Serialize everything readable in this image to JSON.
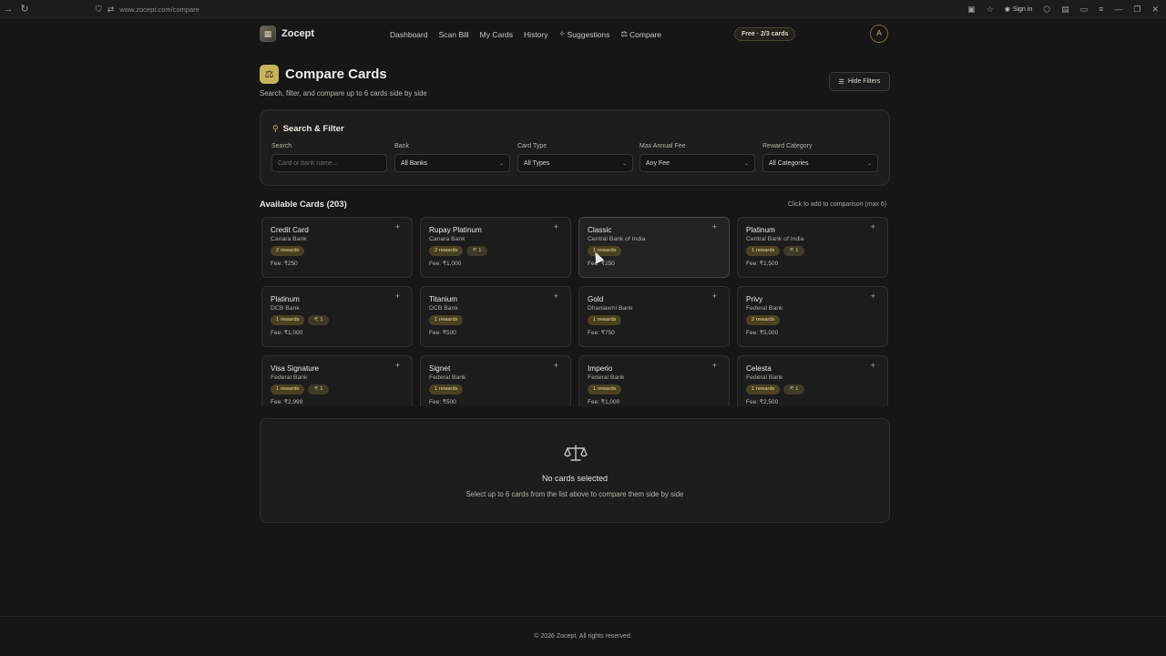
{
  "browser": {
    "url": "www.zocept.com/compare",
    "sign_in": "Sign in"
  },
  "header": {
    "logo": "Zocept",
    "nav": [
      "Dashboard",
      "Scan Bill",
      "My Cards",
      "History",
      "Suggestions",
      "Compare"
    ],
    "plan_badge": "Free · 2/3 cards",
    "avatar": "A"
  },
  "page": {
    "title": "Compare Cards",
    "subtitle": "Search, filter, and compare up to 6 cards side by side",
    "hide_filters": "Hide Filters"
  },
  "filters": {
    "heading": "Search & Filter",
    "search_label": "Search",
    "search_placeholder": "Card or bank name...",
    "bank_label": "Bank",
    "bank_value": "All Banks",
    "type_label": "Card Type",
    "type_value": "All Types",
    "fee_label": "Max Annual Fee",
    "fee_value": "Any Fee",
    "reward_label": "Reward Category",
    "reward_value": "All Categories"
  },
  "available": {
    "title": "Available Cards (203)",
    "hint": "Click to add to comparison (max 6)"
  },
  "cards": [
    {
      "name": "Credit Card",
      "bank": "Canara Bank",
      "rewards": "2 rewards",
      "cashback": "",
      "fee": "Fee: ₹250"
    },
    {
      "name": "Rupay Platinum",
      "bank": "Canara Bank",
      "rewards": "2 rewards",
      "cashback": "1",
      "fee": "Fee: ₹1,000"
    },
    {
      "name": "Classic",
      "bank": "Central Bank of India",
      "rewards": "1 rewards",
      "cashback": "",
      "fee": "Fee: ₹250"
    },
    {
      "name": "Platinum",
      "bank": "Central Bank of India",
      "rewards": "1 rewards",
      "cashback": "1",
      "fee": "Fee: ₹1,500"
    },
    {
      "name": "Platinum",
      "bank": "DCB Bank",
      "rewards": "1 rewards",
      "cashback": "1",
      "fee": "Fee: ₹1,000"
    },
    {
      "name": "Titanium",
      "bank": "DCB Bank",
      "rewards": "1 rewards",
      "cashback": "",
      "fee": "Fee: ₹500"
    },
    {
      "name": "Gold",
      "bank": "Dhanlaxmi Bank",
      "rewards": "1 rewards",
      "cashback": "",
      "fee": "Fee: ₹750"
    },
    {
      "name": "Privy",
      "bank": "Federal Bank",
      "rewards": "2 rewards",
      "cashback": "",
      "fee": "Fee: ₹5,000"
    },
    {
      "name": "Visa Signature",
      "bank": "Federal Bank",
      "rewards": "1 rewards",
      "cashback": "1",
      "fee": "Fee: ₹2,999"
    },
    {
      "name": "Signet",
      "bank": "Federal Bank",
      "rewards": "1 rewards",
      "cashback": "",
      "fee": "Fee: ₹500"
    },
    {
      "name": "Imperio",
      "bank": "Federal Bank",
      "rewards": "1 rewards",
      "cashback": "",
      "fee": "Fee: ₹1,000"
    },
    {
      "name": "Celesta",
      "bank": "Federal Bank",
      "rewards": "1 rewards",
      "cashback": "1",
      "fee": "Fee: ₹2,500"
    }
  ],
  "comparison": {
    "empty_title": "No cards selected",
    "empty_desc": "Select up to 6 cards from the list above to compare them side by side"
  },
  "footer": {
    "text": "© 2026 Zocept. All rights reserved."
  }
}
